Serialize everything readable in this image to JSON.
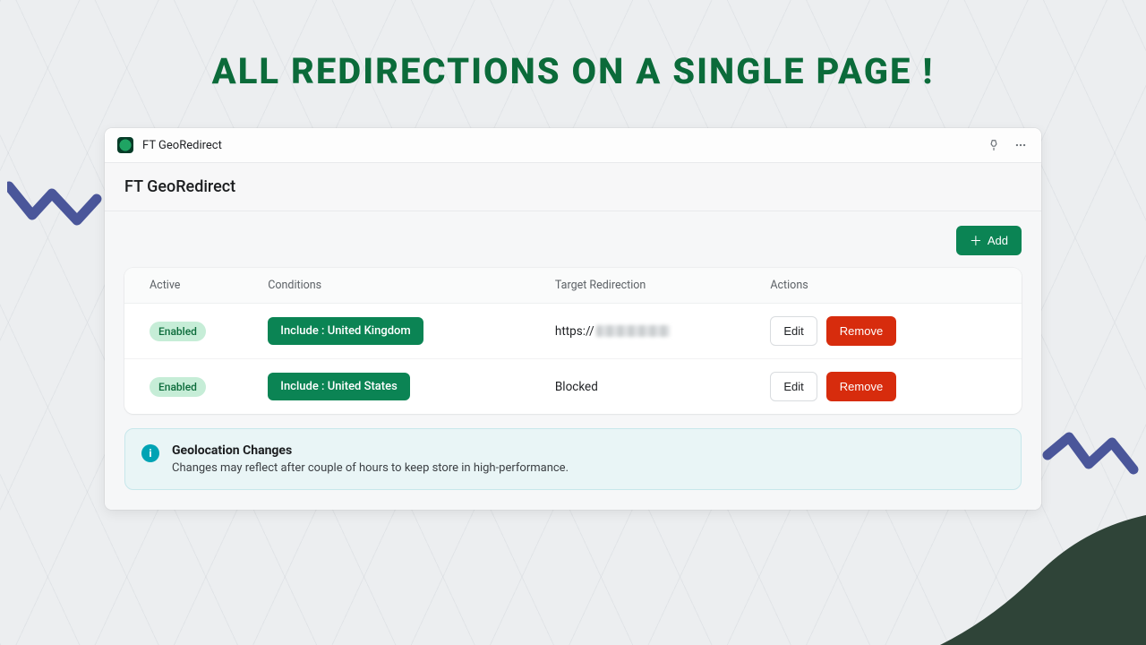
{
  "headline": "ALL REDIRECTIONS ON A SINGLE PAGE !",
  "titlebar": {
    "app_name": "FT GeoRedirect"
  },
  "subheader": {
    "title": "FT GeoRedirect"
  },
  "toolbar": {
    "add_label": "Add"
  },
  "table": {
    "columns": {
      "active": "Active",
      "conditions": "Conditions",
      "target": "Target Redirection",
      "actions": "Actions"
    },
    "rows": [
      {
        "status": "Enabled",
        "condition": "Include : United Kingdom",
        "target_prefix": "https://",
        "target_obscured": true,
        "edit_label": "Edit",
        "remove_label": "Remove"
      },
      {
        "status": "Enabled",
        "condition": "Include : United States",
        "target_prefix": "Blocked",
        "target_obscured": false,
        "edit_label": "Edit",
        "remove_label": "Remove"
      }
    ]
  },
  "info": {
    "title": "Geolocation Changes",
    "body": "Changes may reflect after couple of hours to keep store in high-performance."
  },
  "colors": {
    "brand_green": "#0b8454",
    "headline_green": "#0b6b3a",
    "danger_red": "#d72c0d",
    "info_cyan": "#00a3b4"
  }
}
